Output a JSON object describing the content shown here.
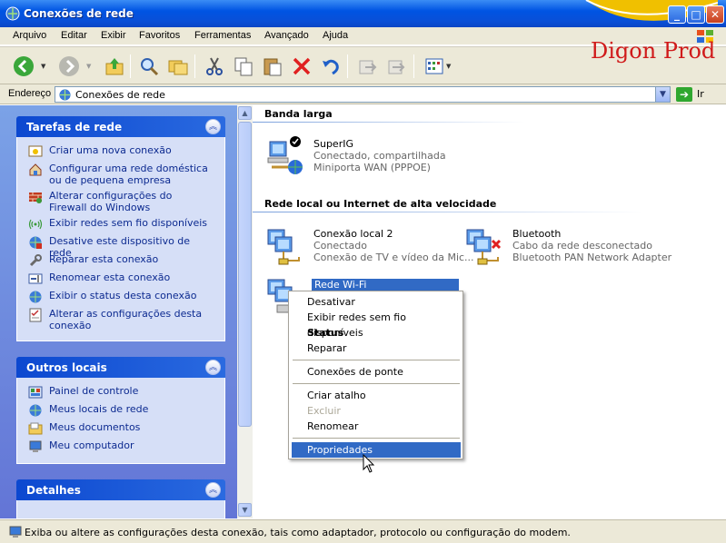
{
  "window": {
    "title": "Conexões de rede"
  },
  "brand": {
    "text": "Digon Prod"
  },
  "menu": [
    "Arquivo",
    "Editar",
    "Exibir",
    "Favoritos",
    "Ferramentas",
    "Avançado",
    "Ajuda"
  ],
  "address": {
    "label": "Endereço",
    "value": "Conexões de rede",
    "go_label": "Ir"
  },
  "sidebar": {
    "tasks": {
      "title": "Tarefas de rede",
      "items": [
        "Criar uma nova conexão",
        "Configurar uma rede doméstica ou de pequena empresa",
        "Alterar configurações do Firewall do Windows",
        "Exibir redes sem fio disponíveis",
        "Desative este dispositivo de rede",
        "Reparar esta conexão",
        "Renomear esta conexão",
        "Exibir o status desta conexão",
        "Alterar as configurações desta conexão"
      ]
    },
    "other": {
      "title": "Outros locais",
      "items": [
        "Painel de controle",
        "Meus locais de rede",
        "Meus documentos",
        "Meu computador"
      ]
    },
    "details": {
      "title": "Detalhes"
    }
  },
  "groups": {
    "broadband": {
      "title": "Banda larga",
      "conn": {
        "name": "SuperIG",
        "status": "Conectado, compartilhada",
        "device": "Miniporta WAN (PPPOE)"
      }
    },
    "lan": {
      "title": "Rede local ou Internet de alta velocidade",
      "local2": {
        "name": "Conexão local 2",
        "status": "Conectado",
        "device": "Conexão de TV e vídeo da Mic..."
      },
      "bluetooth": {
        "name": "Bluetooth",
        "status": "Cabo da rede desconectado",
        "device": "Bluetooth PAN Network Adapter"
      },
      "wifi": {
        "name": "Rede Wi-Fi"
      }
    }
  },
  "context_menu": {
    "items": [
      "Desativar",
      "Exibir redes sem fio disponíveis",
      "Status",
      "Reparar",
      "Conexões de ponte",
      "Criar atalho",
      "Excluir",
      "Renomear",
      "Propriedades"
    ]
  },
  "statusbar": {
    "text": "Exiba ou altere as configurações desta conexão, tais como adaptador, protocolo ou configuração do modem."
  },
  "colors": {
    "titlebar": "#0054e3",
    "sidebar": "#6f8fdd",
    "menu_highlight": "#316ac5",
    "brand": "#d01a1a"
  }
}
